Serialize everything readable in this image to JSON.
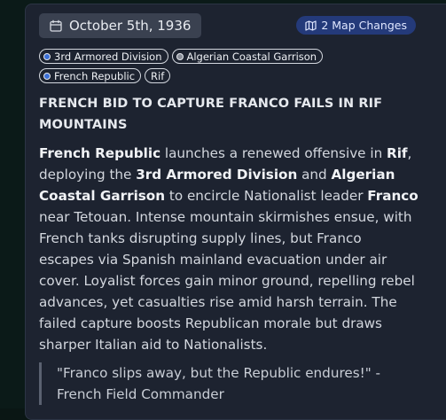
{
  "event": {
    "date": "October 5th, 1936",
    "map_changes_label": "2 Map Changes",
    "tags": [
      {
        "label": "3rd Armored Division",
        "dot_color": "#3b6fd6"
      },
      {
        "label": "Algerian Coastal Garrison",
        "dot_color": "#8a8f99"
      },
      {
        "label": "French Republic",
        "dot_color": "#3b6fd6"
      },
      {
        "label": "Rif",
        "dot_color": ""
      }
    ],
    "headline": "FRENCH BID TO CAPTURE FRANCO FAILS IN RIF MOUNTAINS",
    "body": {
      "s1_bold": "French Republic",
      "s2": " launches a renewed offensive in ",
      "s3_bold": "Rif",
      "s4": ", deploying the ",
      "s5_bold": "3rd Armored Division",
      "s6": " and ",
      "s7_bold": "Algerian Coastal Garrison",
      "s8": " to encircle Nationalist leader ",
      "s9_bold": "Franco",
      "s10": " near Tetouan. Intense mountain skirmishes ensue, with French tanks disrupting supply lines, but Franco escapes via Spanish mainland evacuation under air cover. Loyalist forces gain minor ground, repelling rebel advances, yet casualties rise amid harsh terrain. The failed capture boosts Republican morale but draws sharper Italian aid to Nationalists."
    },
    "quote": "\"Franco slips away, but the Republic endures!\" - French Field Commander"
  },
  "colors": {
    "card_bg": "#1d2330",
    "badge_bg": "#243a7a",
    "date_pill_bg": "#3a4150"
  }
}
